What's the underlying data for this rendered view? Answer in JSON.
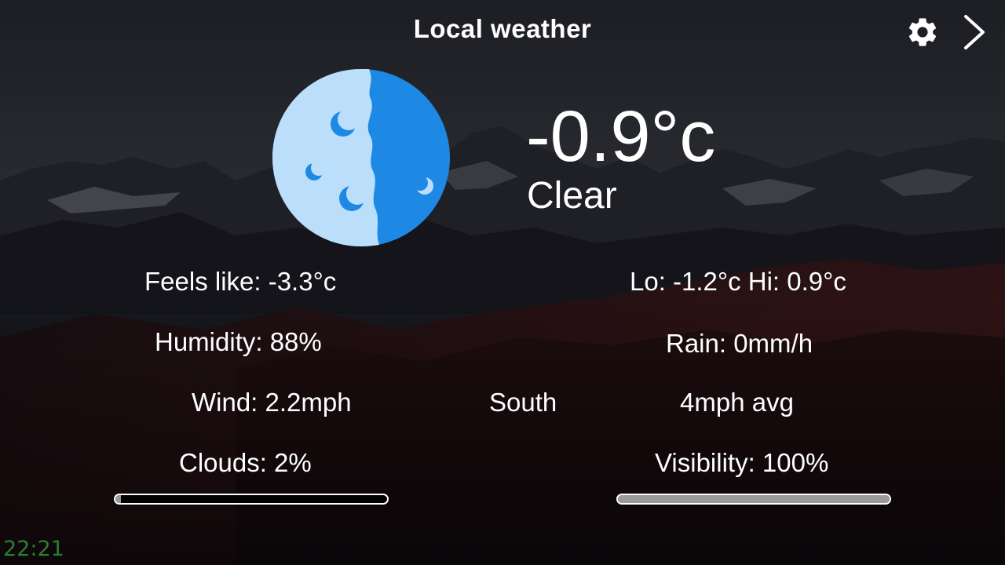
{
  "header": {
    "title": "Local weather",
    "settings_icon": "gear-icon",
    "next_icon": "chevron-right-icon"
  },
  "current": {
    "icon": "moon-clear-night-icon",
    "temperature": "-0.9°c",
    "condition": "Clear"
  },
  "details": {
    "feels_like": "Feels like: -3.3°c",
    "lo_hi": "Lo: -1.2°c  Hi: 0.9°c",
    "humidity": "Humidity: 88%",
    "rain": "Rain: 0mm/h",
    "wind_speed": "Wind: 2.2mph",
    "wind_direction": "South",
    "wind_avg": "4mph avg",
    "clouds": "Clouds: 2%",
    "visibility": "Visibility: 100%"
  },
  "bars": {
    "clouds_fraction": 0.02,
    "visibility_fraction": 1.0
  },
  "clock": "22:21",
  "colors": {
    "text": "#ffffff",
    "clock": "#2e7d32",
    "moon_light": "#bbdefb",
    "moon_dark": "#1e88e5",
    "bar_fill": "#9a9a9a"
  }
}
